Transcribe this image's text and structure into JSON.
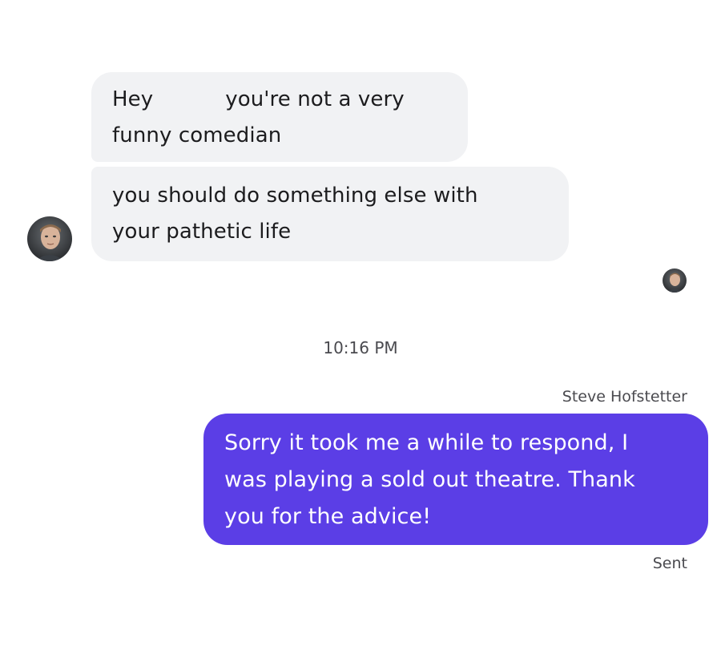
{
  "incoming_messages": [
    {
      "lines": [
        "Hey",
        "you're not a very",
        "funny comedian"
      ]
    },
    {
      "lines": [
        "you should do something else with",
        "your pathetic life"
      ]
    }
  ],
  "timestamp": "10:16 PM",
  "outgoing_message": {
    "sender_name": "Steve Hofstetter",
    "lines": [
      "Sorry it took me a while to respond, I",
      "was playing a sold out theatre. Thank",
      "you for the advice!"
    ],
    "status": "Sent"
  },
  "colors": {
    "incoming_bubble": "#f1f2f4",
    "outgoing_bubble": "#5b3ee6",
    "meta_text": "#4a4a4f"
  },
  "icons": {
    "sender_avatar": "avatar-photo",
    "read_receipt": "avatar-photo-small"
  }
}
